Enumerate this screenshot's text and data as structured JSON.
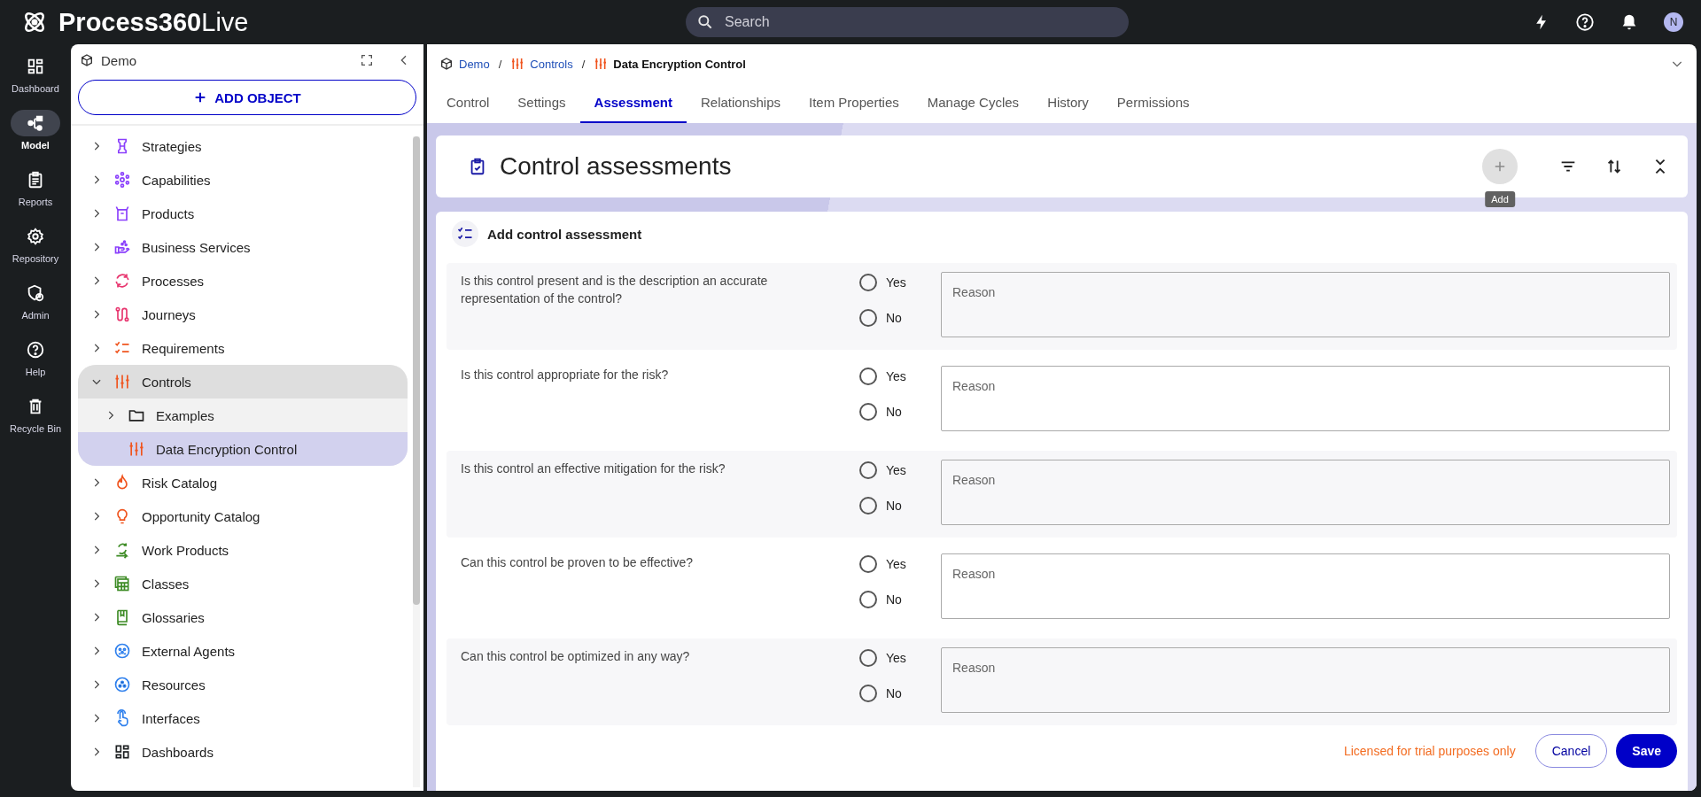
{
  "app": {
    "name_bold": "Process360",
    "name_light": "Live"
  },
  "search": {
    "placeholder": "Search"
  },
  "user": {
    "initial": "N"
  },
  "rail": [
    {
      "label": "Dashboard",
      "selected": false
    },
    {
      "label": "Model",
      "selected": true
    },
    {
      "label": "Reports",
      "selected": false
    },
    {
      "label": "Repository",
      "selected": false
    },
    {
      "label": "Admin",
      "selected": false
    },
    {
      "label": "Help",
      "selected": false
    },
    {
      "label": "Recycle Bin",
      "selected": false
    }
  ],
  "tree_panel": {
    "title": "Demo",
    "add_button": "ADD OBJECT",
    "items": [
      {
        "label": "Strategies",
        "color": "#8a3ffc",
        "expanded": false,
        "selected": false
      },
      {
        "label": "Capabilities",
        "color": "#8a3ffc",
        "expanded": false,
        "selected": false
      },
      {
        "label": "Products",
        "color": "#8a3ffc",
        "expanded": false,
        "selected": false
      },
      {
        "label": "Business Services",
        "color": "#8a3ffc",
        "expanded": false,
        "selected": false
      },
      {
        "label": "Processes",
        "color": "#e8366f",
        "expanded": false,
        "selected": false
      },
      {
        "label": "Journeys",
        "color": "#e8366f",
        "expanded": false,
        "selected": false
      },
      {
        "label": "Requirements",
        "color": "#f0541e",
        "expanded": false,
        "selected": false
      },
      {
        "label": "Controls",
        "color": "#f0541e",
        "expanded": true,
        "selected": false,
        "children": [
          {
            "label": "Examples",
            "kind": "folder",
            "expanded": false,
            "selected": false
          },
          {
            "label": "Data Encryption Control",
            "kind": "control",
            "selected": true
          }
        ]
      },
      {
        "label": "Risk Catalog",
        "color": "#f0541e",
        "expanded": false,
        "selected": false
      },
      {
        "label": "Opportunity Catalog",
        "color": "#f0541e",
        "expanded": false,
        "selected": false
      },
      {
        "label": "Work Products",
        "color": "#3d8b25",
        "expanded": false,
        "selected": false
      },
      {
        "label": "Classes",
        "color": "#3d8b25",
        "expanded": false,
        "selected": false
      },
      {
        "label": "Glossaries",
        "color": "#3d8b25",
        "expanded": false,
        "selected": false
      },
      {
        "label": "External Agents",
        "color": "#2f80ed",
        "expanded": false,
        "selected": false
      },
      {
        "label": "Resources",
        "color": "#2f80ed",
        "expanded": false,
        "selected": false
      },
      {
        "label": "Interfaces",
        "color": "#2f80ed",
        "expanded": false,
        "selected": false
      },
      {
        "label": "Dashboards",
        "color": "#1b1e20",
        "expanded": false,
        "selected": false
      }
    ]
  },
  "breadcrumb": [
    {
      "label": "Demo",
      "link": true
    },
    {
      "separator": "/",
      "label": "Controls",
      "link": true
    },
    {
      "separator": "/",
      "label": "Data Encryption Control",
      "link": false
    }
  ],
  "tabs": [
    {
      "label": "Control",
      "selected": false
    },
    {
      "label": "Settings",
      "selected": false
    },
    {
      "label": "Assessment",
      "selected": true
    },
    {
      "label": "Relationships",
      "selected": false
    },
    {
      "label": "Item Properties",
      "selected": false
    },
    {
      "label": "Manage Cycles",
      "selected": false
    },
    {
      "label": "History",
      "selected": false
    },
    {
      "label": "Permissions",
      "selected": false
    }
  ],
  "section": {
    "title": "Control assessments",
    "add_tooltip": "Add"
  },
  "form": {
    "title": "Add control assessment",
    "questions": [
      {
        "text": "Is this control present and is the description an accurate representation of the control?",
        "options": [
          {
            "label": "Yes",
            "selected": false
          },
          {
            "label": "No",
            "selected": false
          }
        ],
        "reason_placeholder": "Reason"
      },
      {
        "text": "Is this control appropriate for the risk?",
        "options": [
          {
            "label": "Yes",
            "selected": false
          },
          {
            "label": "No",
            "selected": false
          }
        ],
        "reason_placeholder": "Reason"
      },
      {
        "text": "Is this control an effective mitigation for the risk?",
        "options": [
          {
            "label": "Yes",
            "selected": false
          },
          {
            "label": "No",
            "selected": false
          }
        ],
        "reason_placeholder": "Reason"
      },
      {
        "text": "Can this control be proven to be effective?",
        "options": [
          {
            "label": "Yes",
            "selected": false
          },
          {
            "label": "No",
            "selected": false
          }
        ],
        "reason_placeholder": "Reason"
      },
      {
        "text": "Can this control be optimized in any way?",
        "options": [
          {
            "label": "Yes",
            "selected": false
          },
          {
            "label": "No",
            "selected": false
          }
        ],
        "reason_placeholder": "Reason"
      }
    ],
    "buttons": {
      "cancel": "Cancel",
      "save": "Save"
    }
  },
  "license": "Licensed for trial purposes only"
}
